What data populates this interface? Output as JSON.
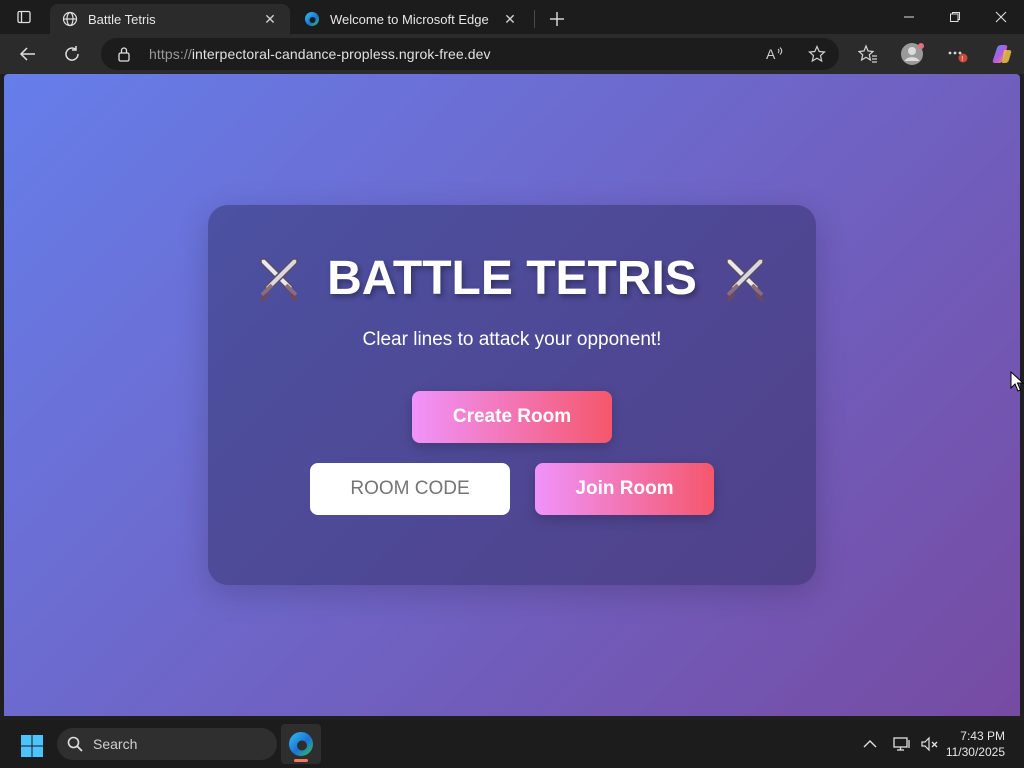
{
  "browser": {
    "tabs": [
      {
        "title": "Battle Tetris",
        "icon": "globe-icon",
        "active": true
      },
      {
        "title": "Welcome to Microsoft Edge",
        "icon": "edge-icon",
        "active": false
      }
    ],
    "address_bar": {
      "scheme": "https://",
      "host": "interpectoral-candance-propless.ngrok-free.dev"
    }
  },
  "page": {
    "title": "BATTLE TETRIS",
    "title_icon": "crossed-swords-icon",
    "subtitle": "Clear lines to attack your opponent!",
    "create_button": "Create Room",
    "room_code_placeholder": "ROOM CODE",
    "join_button": "Join Room",
    "colors": {
      "bg_start": "#667eea",
      "bg_end": "#764ba2",
      "button_start": "#f093fb",
      "button_end": "#f5576c"
    }
  },
  "taskbar": {
    "search_label": "Search",
    "time": "7:43 PM",
    "date": "11/30/2025"
  }
}
